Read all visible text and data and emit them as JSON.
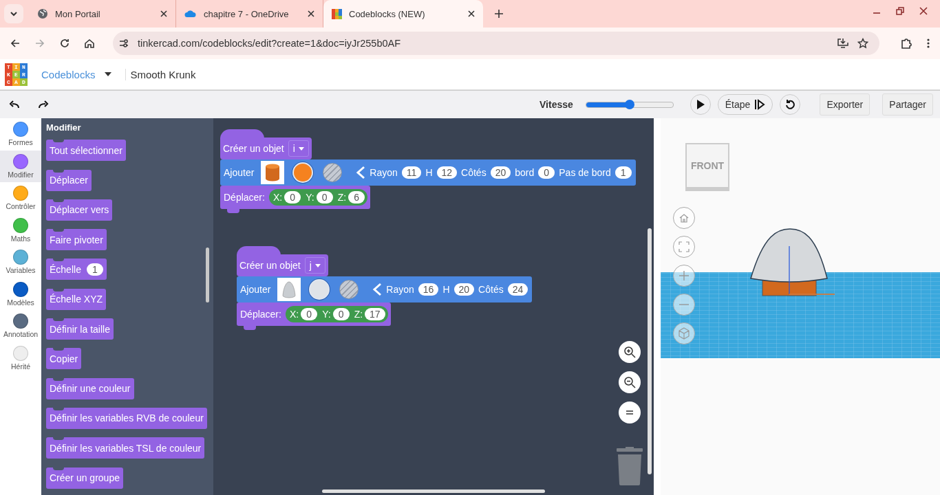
{
  "browser": {
    "tabs": [
      {
        "title": "Mon Portail",
        "kind": "globe",
        "selected": false
      },
      {
        "title": "chapitre 7 - OneDrive",
        "kind": "cloud",
        "selected": false
      },
      {
        "title": "Codeblocks (NEW)",
        "kind": "logo",
        "selected": true
      }
    ],
    "url": "tinkercad.com/codeblocks/edit?create=1&doc=iyJr255b0AF"
  },
  "app": {
    "logo_rows": [
      "TIN",
      "KER",
      "CAD"
    ],
    "mode": "Codeblocks",
    "project": "Smooth Krunk"
  },
  "toolbar": {
    "speed_label": "Vitesse",
    "speed": {
      "level": 0.5
    },
    "step": "Étape",
    "export": "Exporter",
    "share": "Partager"
  },
  "categories": [
    {
      "label": "Formes",
      "color": "#4c97ff",
      "selected": false
    },
    {
      "label": "Modifier",
      "color": "#9966ff",
      "selected": true
    },
    {
      "label": "Contrôler",
      "color": "#ffab19",
      "selected": false
    },
    {
      "label": "Maths",
      "color": "#40bf4a",
      "selected": false
    },
    {
      "label": "Variables",
      "color": "#5cb1d6",
      "selected": false
    },
    {
      "label": "Modèles",
      "color": "#0a5bc4",
      "selected": false
    },
    {
      "label": "Annotation",
      "color": "#5a6b82",
      "selected": false
    },
    {
      "label": "Hérité",
      "color": "#eeeeee",
      "selected": false
    }
  ],
  "palette": {
    "title": "Modifier",
    "blocks": [
      {
        "label": "Tout sélectionner"
      },
      {
        "label": "Déplacer"
      },
      {
        "label": "Déplacer vers"
      },
      {
        "label": "Faire pivoter"
      },
      {
        "label": "Échelle",
        "value": "1"
      },
      {
        "label": "Échelle XYZ"
      },
      {
        "label": "Définir la taille"
      },
      {
        "label": "Copier"
      },
      {
        "label": "Définir une couleur"
      },
      {
        "label": "Définir les variables RVB de couleur"
      },
      {
        "label": "Définir les variables TSL de couleur"
      },
      {
        "label": "Créer un groupe"
      }
    ]
  },
  "scripts": [
    {
      "create": {
        "label": "Créer un objet",
        "variable": "i"
      },
      "add": {
        "label": "Ajouter",
        "kind": "cylinder",
        "color": "#f5821f",
        "params": [
          {
            "label": "Rayon",
            "value": "11"
          },
          {
            "label": "H",
            "value": "12"
          },
          {
            "label": "Côtés",
            "value": "20"
          },
          {
            "label": "bord",
            "value": "0"
          },
          {
            "label": "Pas de bord",
            "value": "1"
          }
        ]
      },
      "move": {
        "label": "Déplacer:",
        "coords": [
          {
            "label": "X:",
            "value": "0"
          },
          {
            "label": "Y:",
            "value": "0"
          },
          {
            "label": "Z:",
            "value": "6"
          }
        ]
      }
    },
    {
      "create": {
        "label": "Créer un objet",
        "variable": "j"
      },
      "add": {
        "label": "Ajouter",
        "kind": "paraboloid",
        "color": "#dfe3e8",
        "params": [
          {
            "label": "Rayon",
            "value": "16"
          },
          {
            "label": "H",
            "value": "20"
          },
          {
            "label": "Côtés",
            "value": "24"
          }
        ]
      },
      "move": {
        "label": "Déplacer:",
        "coords": [
          {
            "label": "X:",
            "value": "0"
          },
          {
            "label": "Y:",
            "value": "0"
          },
          {
            "label": "Z:",
            "value": "17"
          }
        ]
      }
    }
  ],
  "viewer": {
    "view_cube_label": "FRONT"
  }
}
